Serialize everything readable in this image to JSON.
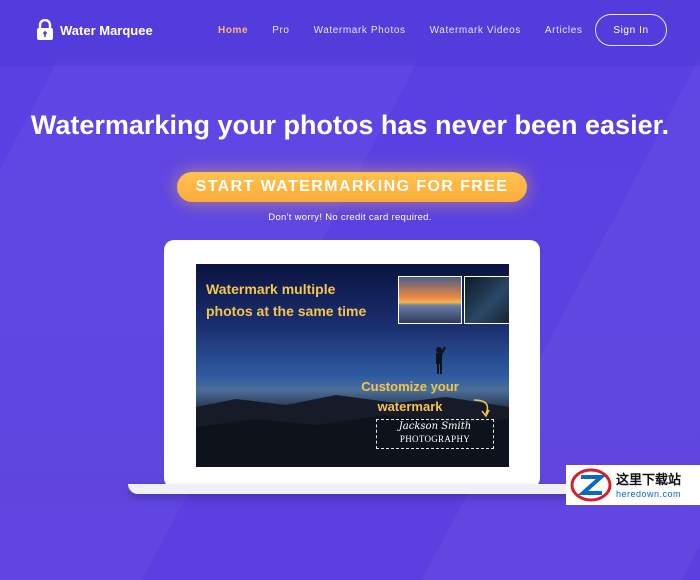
{
  "header": {
    "brand": "Water Marquee",
    "nav": [
      "Home",
      "Pro",
      "Watermark Photos",
      "Watermark Videos",
      "Articles"
    ],
    "active_nav": "Home",
    "signin": "Sign In"
  },
  "hero": {
    "title": "Watermarking your photos has never been easier.",
    "cta": "START WATERMARKING FOR FREE",
    "note": "Don't worry! No credit card required."
  },
  "preview": {
    "headline_1": "Watermark multiple",
    "headline_2": "photos at the same time",
    "customize_1": "Customize your",
    "customize_2": "watermark",
    "signature_name": "Jackson Smith",
    "signature_sub": "PHOTOGRAPHY"
  },
  "corner_watermark": {
    "text_1": "这里下载站",
    "text_2": "heredown.com"
  },
  "colors": {
    "background": "#5a3fe4",
    "cta": "#fbad3b",
    "active_nav": "#ffb37a",
    "screen_text": "#f5c54c"
  },
  "icons": {
    "logo": "lock-icon"
  }
}
